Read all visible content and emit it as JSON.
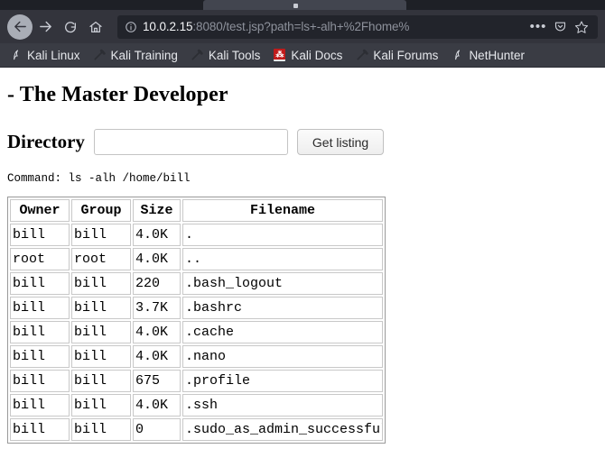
{
  "browser": {
    "tab": {
      "title": ""
    },
    "nav": {
      "back_label": "Back",
      "forward_label": "Forward",
      "reload_label": "Reload",
      "home_label": "Home"
    },
    "urlbar": {
      "identity_icon": "info-icon",
      "host": "10.0.2.15",
      "path": ":8080/test.jsp?path=ls+-alh+%2Fhome%",
      "page_actions_label": "•••",
      "reader_icon": "pocket-icon",
      "bookmark_icon": "star-icon"
    },
    "bookmarks": [
      {
        "label": "Kali Linux",
        "icon": "kali-dragon-icon"
      },
      {
        "label": "Kali Training",
        "icon": "kali-tool-icon"
      },
      {
        "label": "Kali Tools",
        "icon": "kali-tool-icon"
      },
      {
        "label": "Kali Docs",
        "icon": "kali-docs-icon",
        "badge": "⁂"
      },
      {
        "label": "Kali Forums",
        "icon": "kali-tool-icon"
      },
      {
        "label": "NetHunter",
        "icon": "kali-dragon-icon"
      }
    ]
  },
  "page": {
    "title": "- The Master Developer",
    "form": {
      "directory_label": "Directory",
      "directory_value": "",
      "directory_placeholder": "",
      "submit_label": "Get listing"
    },
    "command_line": "Command: ls -alh /home/bill",
    "table": {
      "headers": [
        "Owner",
        "Group",
        "Size",
        "Filename"
      ],
      "rows": [
        {
          "owner": "bill",
          "group": "bill",
          "size": "4.0K",
          "filename": "."
        },
        {
          "owner": "root",
          "group": "root",
          "size": "4.0K",
          "filename": ".."
        },
        {
          "owner": "bill",
          "group": "bill",
          "size": "220",
          "filename": ".bash_logout"
        },
        {
          "owner": "bill",
          "group": "bill",
          "size": "3.7K",
          "filename": ".bashrc"
        },
        {
          "owner": "bill",
          "group": "bill",
          "size": "4.0K",
          "filename": ".cache"
        },
        {
          "owner": "bill",
          "group": "bill",
          "size": "4.0K",
          "filename": ".nano"
        },
        {
          "owner": "bill",
          "group": "bill",
          "size": "675",
          "filename": ".profile"
        },
        {
          "owner": "bill",
          "group": "bill",
          "size": "4.0K",
          "filename": ".ssh"
        },
        {
          "owner": "bill",
          "group": "bill",
          "size": "0",
          "filename": ".sudo_as_admin_successful"
        }
      ]
    }
  },
  "colors": {
    "chrome_bg": "#33343c",
    "tabstrip_bg": "#1e2026",
    "urlbar_bg": "#22242b",
    "bookmarks_bg": "#3a3c44",
    "page_bg": "#ffffff",
    "kali_docs_red": "#c11b1b"
  }
}
